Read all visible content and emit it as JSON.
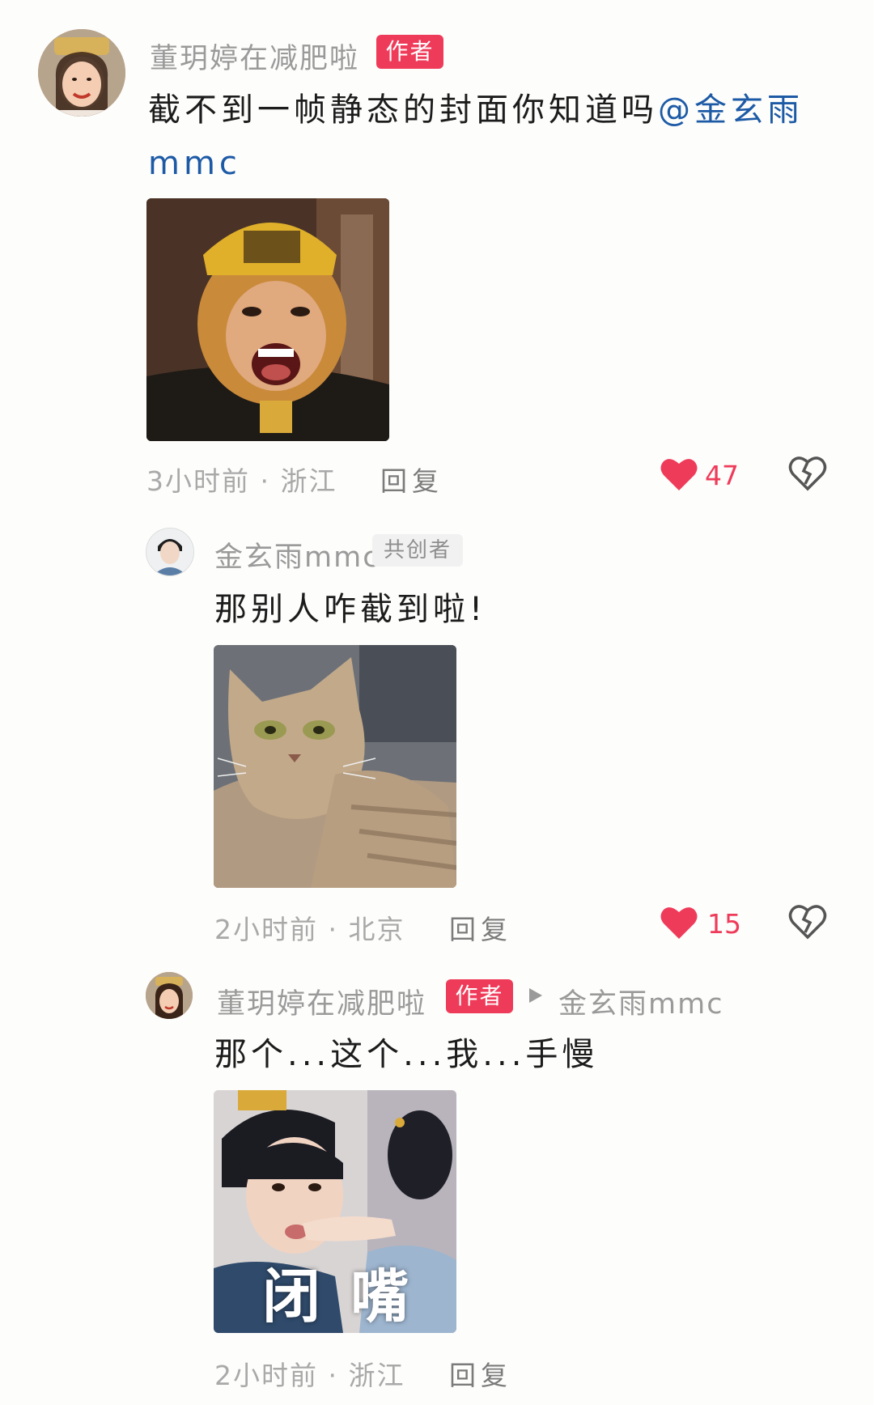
{
  "comments": [
    {
      "username": "董玥婷在减肥啦",
      "badge": "作者",
      "text": "截不到一帧静态的封面你知道吗",
      "mention": "@金玄雨mmc",
      "time_location": "3小时前 · 浙江",
      "reply_label": "回复",
      "likes": "47",
      "image_desc": "monkey-king-laughing"
    },
    {
      "username": "金玄雨mmc",
      "badge": "共创者",
      "text": "那别人咋截到啦!",
      "time_location": "2小时前 · 北京",
      "reply_label": "回复",
      "likes": "15",
      "image_desc": "smug-tabby-cat"
    },
    {
      "username": "董玥婷在减肥啦",
      "badge": "作者",
      "reply_to": "金玄雨mmc",
      "text": "那个...这个...我...手慢",
      "time_location": "2小时前 · 浙江",
      "reply_label": "回复",
      "image_caption": "闭  嘴"
    }
  ],
  "colors": {
    "accent": "#ef3b5a",
    "mention": "#1d5aa6",
    "meta": "#a9a9a9"
  },
  "icons": [
    "heart-icon",
    "dislike-broken-heart-icon",
    "reply-arrow-icon"
  ]
}
